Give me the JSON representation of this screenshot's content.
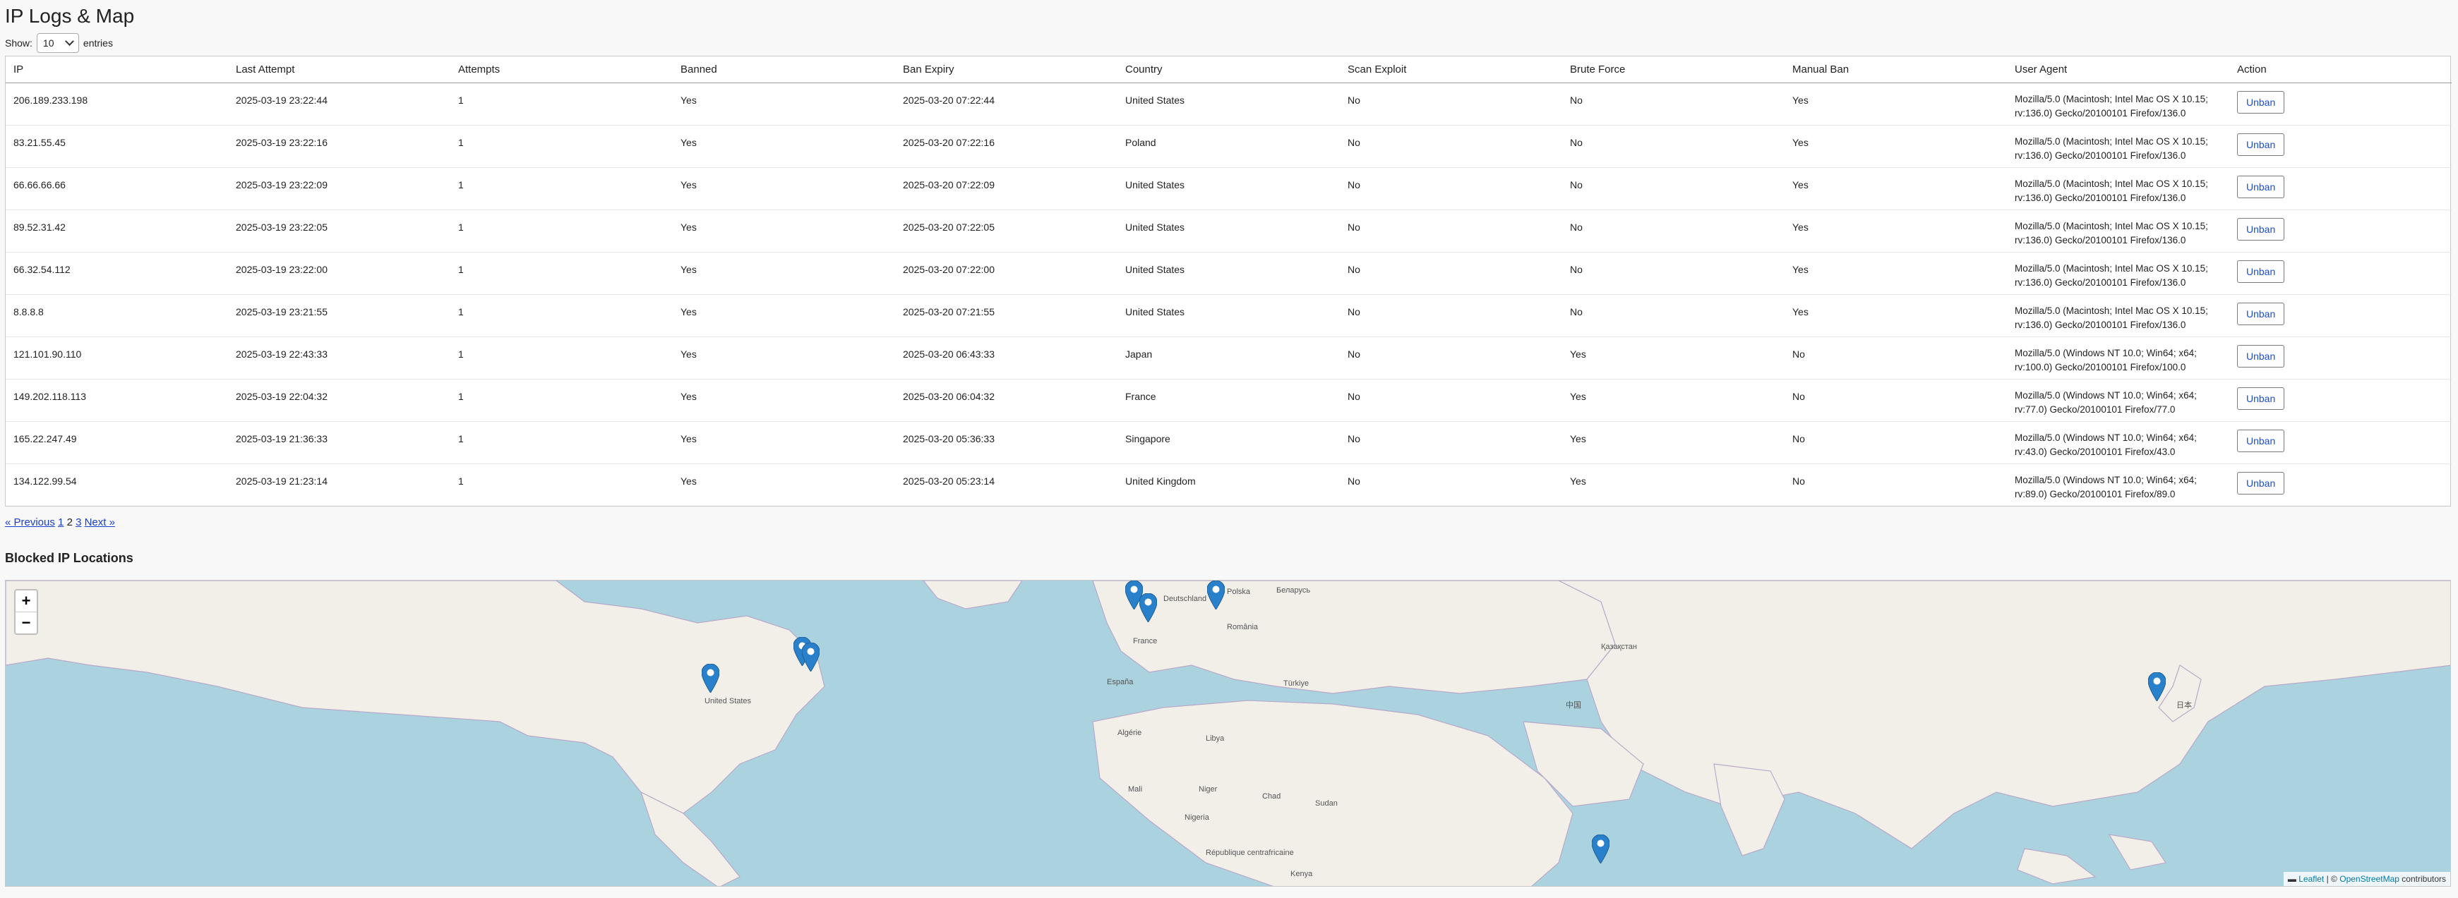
{
  "page": {
    "title": "IP Logs & Map"
  },
  "length_control": {
    "prefix": "Show:",
    "value": "10",
    "suffix": "entries"
  },
  "table": {
    "headers": [
      "IP",
      "Last Attempt",
      "Attempts",
      "Banned",
      "Ban Expiry",
      "Country",
      "Scan Exploit",
      "Brute Force",
      "Manual Ban",
      "User Agent",
      "Action"
    ],
    "action_label": "Unban",
    "rows": [
      [
        "206.189.233.198",
        "2025-03-19 23:22:44",
        "1",
        "Yes",
        "2025-03-20 07:22:44",
        "United States",
        "No",
        "No",
        "Yes",
        "Mozilla/5.0 (Macintosh; Intel Mac OS X 10.15; rv:136.0) Gecko/20100101 Firefox/136.0"
      ],
      [
        "83.21.55.45",
        "2025-03-19 23:22:16",
        "1",
        "Yes",
        "2025-03-20 07:22:16",
        "Poland",
        "No",
        "No",
        "Yes",
        "Mozilla/5.0 (Macintosh; Intel Mac OS X 10.15; rv:136.0) Gecko/20100101 Firefox/136.0"
      ],
      [
        "66.66.66.66",
        "2025-03-19 23:22:09",
        "1",
        "Yes",
        "2025-03-20 07:22:09",
        "United States",
        "No",
        "No",
        "Yes",
        "Mozilla/5.0 (Macintosh; Intel Mac OS X 10.15; rv:136.0) Gecko/20100101 Firefox/136.0"
      ],
      [
        "89.52.31.42",
        "2025-03-19 23:22:05",
        "1",
        "Yes",
        "2025-03-20 07:22:05",
        "United States",
        "No",
        "No",
        "Yes",
        "Mozilla/5.0 (Macintosh; Intel Mac OS X 10.15; rv:136.0) Gecko/20100101 Firefox/136.0"
      ],
      [
        "66.32.54.112",
        "2025-03-19 23:22:00",
        "1",
        "Yes",
        "2025-03-20 07:22:00",
        "United States",
        "No",
        "No",
        "Yes",
        "Mozilla/5.0 (Macintosh; Intel Mac OS X 10.15; rv:136.0) Gecko/20100101 Firefox/136.0"
      ],
      [
        "8.8.8.8",
        "2025-03-19 23:21:55",
        "1",
        "Yes",
        "2025-03-20 07:21:55",
        "United States",
        "No",
        "No",
        "Yes",
        "Mozilla/5.0 (Macintosh; Intel Mac OS X 10.15; rv:136.0) Gecko/20100101 Firefox/136.0"
      ],
      [
        "121.101.90.110",
        "2025-03-19 22:43:33",
        "1",
        "Yes",
        "2025-03-20 06:43:33",
        "Japan",
        "No",
        "Yes",
        "No",
        "Mozilla/5.0 (Windows NT 10.0; Win64; x64; rv:100.0) Gecko/20100101 Firefox/100.0"
      ],
      [
        "149.202.118.113",
        "2025-03-19 22:04:32",
        "1",
        "Yes",
        "2025-03-20 06:04:32",
        "France",
        "No",
        "Yes",
        "No",
        "Mozilla/5.0 (Windows NT 10.0; Win64; x64; rv:77.0) Gecko/20100101 Firefox/77.0"
      ],
      [
        "165.22.247.49",
        "2025-03-19 21:36:33",
        "1",
        "Yes",
        "2025-03-20 05:36:33",
        "Singapore",
        "No",
        "Yes",
        "No",
        "Mozilla/5.0 (Windows NT 10.0; Win64; x64; rv:43.0) Gecko/20100101 Firefox/43.0"
      ],
      [
        "134.122.99.54",
        "2025-03-19 21:23:14",
        "1",
        "Yes",
        "2025-03-20 05:23:14",
        "United Kingdom",
        "No",
        "Yes",
        "No",
        "Mozilla/5.0 (Windows NT 10.0; Win64; x64; rv:89.0) Gecko/20100101 Firefox/89.0"
      ]
    ]
  },
  "pagination": {
    "previous": "« Previous",
    "pages": [
      "1",
      "2",
      "3"
    ],
    "current": "2",
    "next": "Next »"
  },
  "map": {
    "heading": "Blocked IP Locations",
    "zoom_in": "+",
    "zoom_out": "−",
    "attribution_leaflet": "Leaflet",
    "attribution_separator": "| ©",
    "attribution_osm": "OpenStreetMap",
    "attribution_suffix": "contributors",
    "labels": [
      "United States",
      "France",
      "España",
      "Deutschland",
      "Polska",
      "Беларусь",
      "România",
      "Türkiye",
      "Қазақстан",
      "日本",
      "中国",
      "Algérie",
      "Libya",
      "Mali",
      "Niger",
      "Nigeria",
      "Kenya",
      "République centrafricaine",
      "Chad",
      "Sudan"
    ],
    "marker_color": "#2a81cb"
  }
}
